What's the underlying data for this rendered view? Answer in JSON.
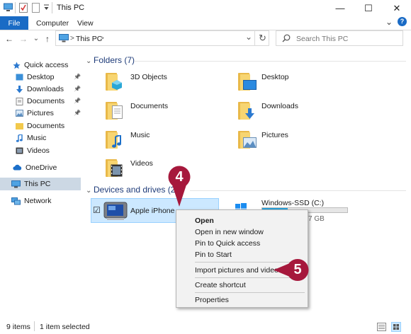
{
  "window": {
    "title": "This PC",
    "minimize_glyph": "—",
    "maximize_glyph": "☐",
    "close_glyph": "✕"
  },
  "ribbon": {
    "tabs": [
      "File",
      "Computer",
      "View"
    ],
    "expand_glyph": "⌄",
    "help_glyph": "?"
  },
  "navbar": {
    "back_glyph": "←",
    "forward_glyph": "→",
    "recent_glyph": "⌄",
    "up_glyph": "↑",
    "address_sep": ">",
    "address_location": "This PC",
    "address_chevron": ">",
    "refresh_glyph": "↻",
    "search_placeholder": "Search This PC"
  },
  "nav_pane": {
    "quick_access": "Quick access",
    "items": [
      {
        "label": "Desktop",
        "pinned": true
      },
      {
        "label": "Downloads",
        "pinned": true
      },
      {
        "label": "Documents",
        "pinned": true
      },
      {
        "label": "Pictures",
        "pinned": true
      },
      {
        "label": "Documents",
        "pinned": false
      },
      {
        "label": "Music",
        "pinned": false
      },
      {
        "label": "Videos",
        "pinned": false
      }
    ],
    "onedrive": "OneDrive",
    "this_pc": "This PC",
    "network": "Network",
    "pin_glyph": "📌"
  },
  "folders": {
    "header": "Folders (7)",
    "items": [
      "3D Objects",
      "Desktop",
      "Documents",
      "Downloads",
      "Music",
      "Pictures",
      "Videos"
    ]
  },
  "devices": {
    "header": "Devices and drives (2)",
    "iphone": "Apple iPhone",
    "checkbox_glyph": "☑",
    "ssd_label": "Windows-SSD (C:)",
    "ssd_free_fragment": "7 GB",
    "ssd_used_fraction": 0.3
  },
  "context_menu": {
    "items": [
      "Open",
      "Open in new window",
      "Pin to Quick access",
      "Pin to Start",
      "Import pictures and videos",
      "Create shortcut",
      "Properties"
    ]
  },
  "callouts": {
    "step4": "4",
    "step5": "5",
    "color": "#a6183c"
  },
  "status": {
    "items_count": "9 items",
    "selection": "1 item selected"
  }
}
